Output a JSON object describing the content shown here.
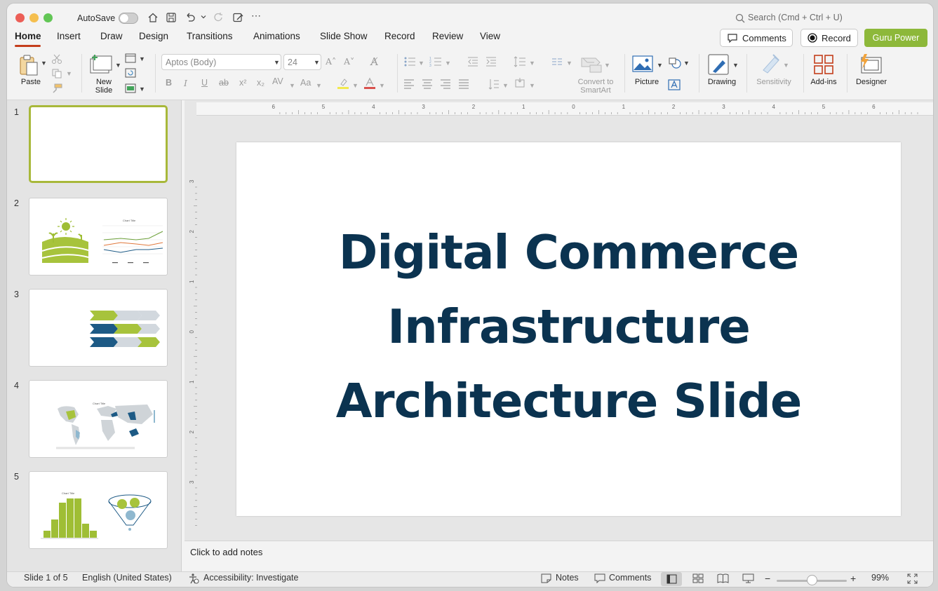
{
  "window": {
    "close_color": "#ec5f57",
    "minimize_color": "#f5bf4f",
    "zoom_color": "#62c655"
  },
  "titlebar": {
    "autosave_label": "AutoSave",
    "search_placeholder": "Search (Cmd + Ctrl + U)"
  },
  "tabs": [
    {
      "label": "Home",
      "active": true
    },
    {
      "label": "Insert"
    },
    {
      "label": "Draw"
    },
    {
      "label": "Design"
    },
    {
      "label": "Transitions"
    },
    {
      "label": "Animations"
    },
    {
      "label": "Slide Show"
    },
    {
      "label": "Record"
    },
    {
      "label": "Review"
    },
    {
      "label": "View"
    }
  ],
  "top_buttons": {
    "comments_label": "Comments",
    "record_label": "Record",
    "guru_label": "Guru Power",
    "guru_color": "#8db83a"
  },
  "ribbon": {
    "paste_label": "Paste",
    "new_slide_label": "New\nSlide",
    "font_name": "Aptos (Body)",
    "font_size": "24",
    "convert_label": "Convert to\nSmartArt",
    "picture_label": "Picture",
    "drawing_label": "Drawing",
    "sensitivity_label": "Sensitivity",
    "addins_label": "Add-ins",
    "designer_label": "Designer"
  },
  "ruler": {
    "h_labels": [
      "6",
      "5",
      "4",
      "3",
      "2",
      "1",
      "0",
      "1",
      "2",
      "3",
      "4",
      "5",
      "6"
    ],
    "v_labels": [
      "3",
      "2",
      "1",
      "0",
      "1",
      "2",
      "3"
    ]
  },
  "slides": [
    {
      "number": "1",
      "selected": true
    },
    {
      "number": "2",
      "chart_title": "Chart Title"
    },
    {
      "number": "3"
    },
    {
      "number": "4",
      "chart_title": "Chart Title"
    },
    {
      "number": "5",
      "chart_title": "Chart Title"
    }
  ],
  "current_slide": {
    "title_lines": [
      "Digital Commerce",
      "Infrastructure",
      "Architecture Slide"
    ],
    "title_color": "#0b3350"
  },
  "notes": {
    "placeholder": "Click to add notes"
  },
  "status": {
    "slide_info": "Slide 1 of 5",
    "language": "English (United States)",
    "accessibility": "Accessibility: Investigate",
    "notes_label": "Notes",
    "comments_label": "Comments",
    "zoom": "99%",
    "zoom_fraction": 0.5
  },
  "accent_color": "#c43e1c"
}
